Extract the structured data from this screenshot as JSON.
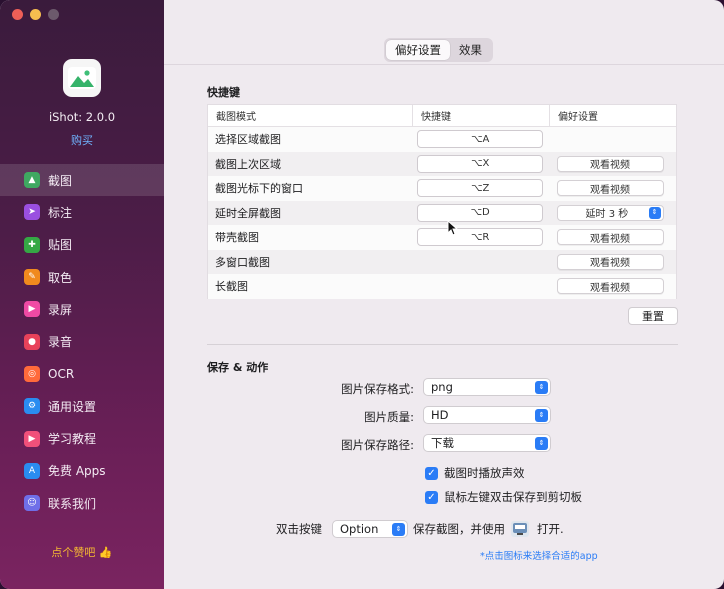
{
  "app": {
    "title": "iShot: 2.0.0",
    "buy_label": "购买",
    "like_label": "点个赞吧 👍"
  },
  "sidebar": {
    "items": [
      {
        "label": "截图",
        "icon": "image-icon",
        "color": "#3fa861",
        "glyph": "▲",
        "active": true
      },
      {
        "label": "标注",
        "icon": "pointer-icon",
        "color": "#9a4fe0",
        "glyph": "➤",
        "active": false
      },
      {
        "label": "贴图",
        "icon": "pin-icon",
        "color": "#35a845",
        "glyph": "✚",
        "active": false
      },
      {
        "label": "取色",
        "icon": "eyedropper-icon",
        "color": "#f08a1e",
        "glyph": "✎",
        "active": false
      },
      {
        "label": "录屏",
        "icon": "video-icon",
        "color": "#ef4aa4",
        "glyph": "▶",
        "active": false
      },
      {
        "label": "录音",
        "icon": "microphone-icon",
        "color": "#e8425a",
        "glyph": "●",
        "active": false
      },
      {
        "label": "OCR",
        "icon": "ocr-icon",
        "color": "#ff6a3b",
        "glyph": "◎",
        "active": false
      },
      {
        "label": "通用设置",
        "icon": "gear-icon",
        "color": "#2a8cf0",
        "glyph": "⚙",
        "active": false
      },
      {
        "label": "学习教程",
        "icon": "play-icon",
        "color": "#f0507a",
        "glyph": "▶",
        "active": false
      },
      {
        "label": "免费 Apps",
        "icon": "appstore-icon",
        "color": "#2a8cf0",
        "glyph": "A",
        "active": false
      },
      {
        "label": "联系我们",
        "icon": "contacts-icon",
        "color": "#6f6fe8",
        "glyph": "☺",
        "active": false
      }
    ]
  },
  "tabs": [
    {
      "label": "偏好设置",
      "active": true
    },
    {
      "label": "效果",
      "active": false
    }
  ],
  "shortcuts": {
    "section_title": "快捷键",
    "headers": [
      "截图模式",
      "快捷键",
      "偏好设置"
    ],
    "rows": [
      {
        "mode": "选择区域截图",
        "key": "⌥A",
        "pref": null
      },
      {
        "mode": "截图上次区域",
        "key": "⌥X",
        "pref": "观看视频"
      },
      {
        "mode": "截图光标下的窗口",
        "key": "⌥Z",
        "pref": "观看视频"
      },
      {
        "mode": "延时全屏截图",
        "key": "⌥D",
        "pref": "延时 3 秒",
        "pref_type": "select"
      },
      {
        "mode": "带壳截图",
        "key": "⌥R",
        "pref": "观看视频"
      },
      {
        "mode": "多窗口截图",
        "key": null,
        "pref": "观看视频"
      },
      {
        "mode": "长截图",
        "key": null,
        "pref": "观看视频"
      }
    ],
    "reset_label": "重置"
  },
  "save": {
    "section_title": "保存 & 动作",
    "format_label": "图片保存格式:",
    "format_value": "png",
    "quality_label": "图片质量:",
    "quality_value": "HD",
    "path_label": "图片保存路径:",
    "path_value": "下载",
    "sound_label": "截图时播放声效",
    "sound_checked": true,
    "clipboard_label": "鼠标左键双击保存到剪切板",
    "clipboard_checked": true,
    "dbl_label": "双击按键",
    "dbl_value": "Option",
    "dbl_middle": "保存截图，并使用",
    "dbl_open": "打开.",
    "hint": "*点击图标来选择合适的app"
  },
  "colors": {
    "accent": "#2a7cf6",
    "link": "#6fb3ff",
    "like": "#f5b932"
  }
}
